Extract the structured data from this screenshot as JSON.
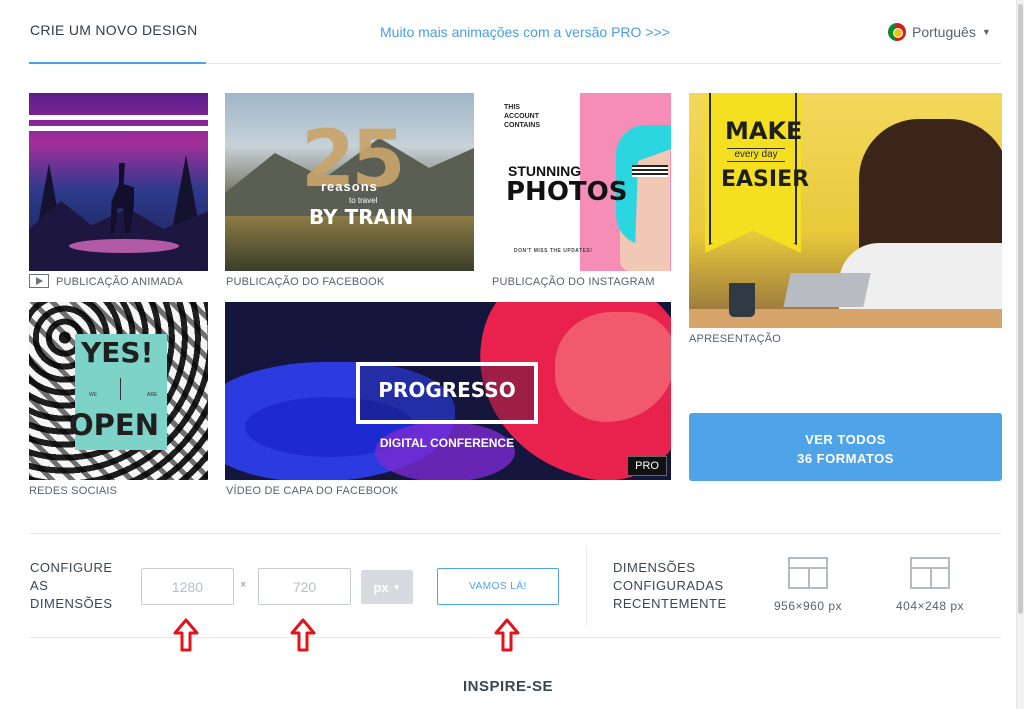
{
  "header": {
    "tab_create": "CRIE UM NOVO DESIGN",
    "pro_link": "Muito mais animações com a versão PRO >>>",
    "language": "Português"
  },
  "cards": [
    {
      "label": "PUBLICAÇÃO ANIMADA",
      "icon": "play-icon"
    },
    {
      "label": "PUBLICAÇÃO DO FACEBOOK",
      "image_text": {
        "number": "25",
        "reasons": "reasons",
        "to_travel": "to travel",
        "by_train": "BY TRAIN"
      }
    },
    {
      "label": "PUBLICAÇÃO DO INSTAGRAM",
      "image_text": {
        "small": "THIS ACCOUNT CONTAINS",
        "stunning": "STUNNING",
        "photos": "PHOTOS",
        "footer": "DON'T MISS THE UPDATES!"
      }
    },
    {
      "label": "APRESENTAÇÃO",
      "image_text": {
        "make": "MAKE",
        "every_day": "every day",
        "easier": "EASIER"
      }
    },
    {
      "label": "REDES SOCIAIS",
      "image_text": {
        "yes": "YES!",
        "we": "WE",
        "are": "ARE",
        "open": "OPEN"
      }
    },
    {
      "label": "VÍDEO DE CAPA DO FACEBOOK",
      "image_text": {
        "progresso": "PROGRESSO",
        "digital": "DIGITAL CONFERENCE"
      },
      "badge": "PRO"
    }
  ],
  "ver_todos": {
    "line1": "VER TODOS",
    "line2": "36 FORMATOS"
  },
  "configure": {
    "label_lines": [
      "CONFIGURE",
      "AS",
      "DIMENSÕES"
    ],
    "width_placeholder": "1280",
    "height_placeholder": "720",
    "times": "×",
    "unit": "px",
    "submit": "VAMOS LÁ!"
  },
  "recent": {
    "label_lines": [
      "DIMENSÕES",
      "CONFIGURADAS",
      "RECENTEMENTE"
    ],
    "items": [
      {
        "size": "956×960 px"
      },
      {
        "size": "404×248 px"
      }
    ]
  },
  "inspire": "INSPIRE-SE",
  "colors": {
    "accent": "#4fa3e8",
    "annotation_arrow": "#e0141b",
    "text": "#3c4551"
  }
}
